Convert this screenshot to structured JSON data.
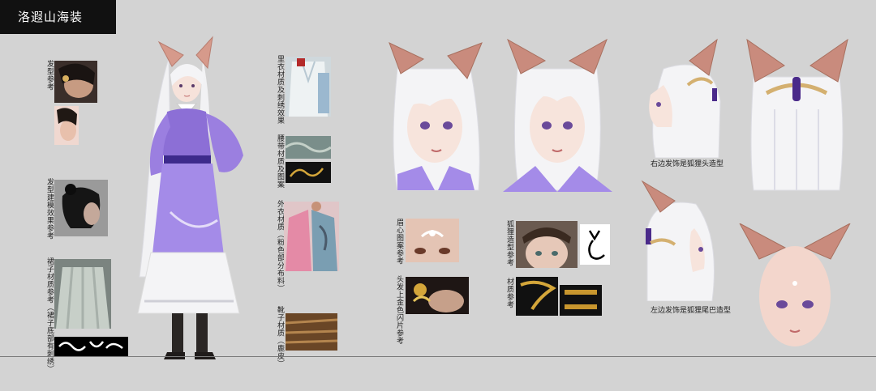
{
  "title": "洛遐山海装",
  "labels": {
    "hair_ref": "发型参考",
    "hair_model_ref": "发型建模效果参考",
    "skirt_ref": "裙子材质参考（裙子底部有刺绣）",
    "inner_ref": "里衣材质及刺绣效果",
    "belt_ref": "腰带材质及图案",
    "outer_ref": "外衣材质（粉色部分布料）",
    "boots_ref": "靴子材质（鹿皮）",
    "brow_ref": "眉心图案参考",
    "hairpin_ref": "头发上金色闪片参考",
    "fox_ref": "狐狸造型参考",
    "material_ref": "材质参考"
  },
  "captions": {
    "right_ornament": "右边发饰是狐狸头造型",
    "left_ornament": "左边发饰是狐狸尾巴造型"
  },
  "colors": {
    "title_bg": "#111111",
    "background": "#d3d3d3",
    "robe_purple": "#8c6fd6",
    "ear_pink": "#c98b7d",
    "hair_white": "#f4f4f6"
  }
}
